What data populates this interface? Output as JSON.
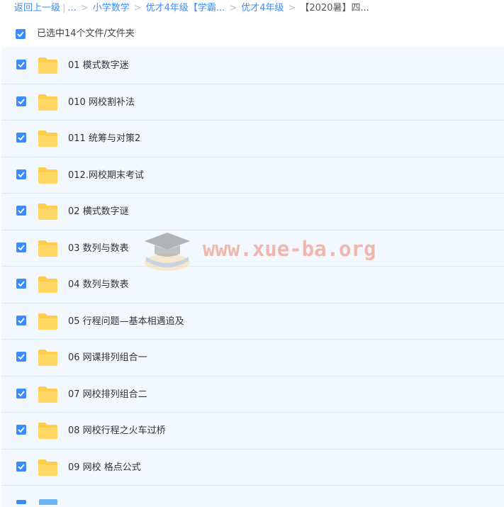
{
  "breadcrumb": {
    "back": "返回上一级",
    "ellipsis": "...",
    "items": [
      "小学数学",
      "优才4年级【学霸...",
      "优才4年级"
    ],
    "current": "【2020暑】四..."
  },
  "selection": {
    "label": "已选中14个文件/文件夹",
    "checked": true
  },
  "files": [
    {
      "name": "01 模式数字迷",
      "checked": true
    },
    {
      "name": "010 网校割补法",
      "checked": true
    },
    {
      "name": "011 统筹与对策2",
      "checked": true
    },
    {
      "name": "012.网校期末考试",
      "checked": true
    },
    {
      "name": "02 横式数字谜",
      "checked": true
    },
    {
      "name": "03 数列与数表",
      "checked": true
    },
    {
      "name": "04 数列与数表",
      "checked": true
    },
    {
      "name": "05 行程问题—基本相遇追及",
      "checked": true
    },
    {
      "name": "06 网课排列组合一",
      "checked": true
    },
    {
      "name": "07 网校排列组合二",
      "checked": true
    },
    {
      "name": "08 网校行程之火车过桥",
      "checked": true
    },
    {
      "name": "09 网校 格点公式",
      "checked": true
    }
  ],
  "watermark": {
    "text": "www.xue-ba.org"
  },
  "colors": {
    "accent": "#3b8cff",
    "row_bg": "#f2f8fe",
    "folder": "#ffcc4d"
  }
}
